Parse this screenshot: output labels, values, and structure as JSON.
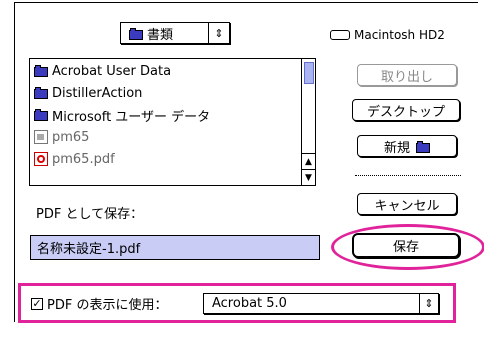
{
  "folder_popup": {
    "label": "書類",
    "arrow": "⇕"
  },
  "disk": {
    "name": "Macintosh HD2"
  },
  "file_list": {
    "items": [
      {
        "name": "Acrobat User Data",
        "icon": "folder-icon",
        "dim": false
      },
      {
        "name": "DistillerAction",
        "icon": "folder-icon",
        "dim": false
      },
      {
        "name": "Microsoft ユーザー データ",
        "icon": "folder-icon",
        "dim": false
      },
      {
        "name": "pm65",
        "icon": "document-icon",
        "dim": true
      },
      {
        "name": "pm65.pdf",
        "icon": "pdf-icon",
        "dim": true
      }
    ]
  },
  "buttons": {
    "eject": "取り出し",
    "desktop": "デスクトップ",
    "new": "新規",
    "cancel": "キャンセル",
    "save": "保存"
  },
  "save_as": {
    "label": "PDF として保存：",
    "filename": "名称未設定-1.pdf"
  },
  "compat": {
    "checkbox_mark": "✓",
    "label": "PDF の表示に使用：",
    "selected": "Acrobat 5.0",
    "arrow": "⇕"
  },
  "colors": {
    "highlight": "#e0239a",
    "selection": "#c9ccf5",
    "folder": "#3b3bbf"
  }
}
